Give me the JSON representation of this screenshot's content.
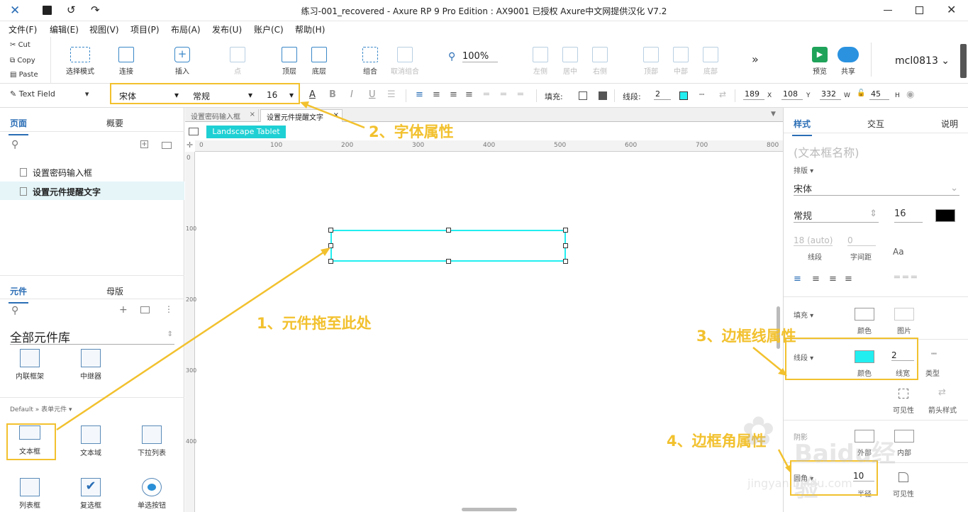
{
  "window": {
    "title": "练习-001_recovered - Axure RP 9 Pro Edition : AX9001 已授权      Axure中文网提供汉化 V7.2",
    "accent": "#2a6db5"
  },
  "menu": [
    "文件(F)",
    "编辑(E)",
    "视图(V)",
    "项目(P)",
    "布局(A)",
    "发布(U)",
    "账户(C)",
    "帮助(H)"
  ],
  "clipboard": {
    "cut": "Cut",
    "copy": "Copy",
    "paste": "Paste"
  },
  "toolbar": {
    "select_mode": "选择模式",
    "connect": "连接",
    "insert": "插入",
    "point": "点",
    "top_layer": "顶层",
    "bottom_layer": "底层",
    "group": "组合",
    "ungroup": "取消组合",
    "zoom": "100%",
    "align_left": "左侧",
    "align_center": "居中",
    "align_right": "右侧",
    "align_top": "顶部",
    "align_middle": "中部",
    "align_bottom": "底部",
    "preview": "预览",
    "share": "共享",
    "user": "mcl0813"
  },
  "format": {
    "widget_type": "Text Field",
    "font": "宋体",
    "weight": "常规",
    "size": "16",
    "fill_label": "填充:",
    "stroke_label": "线段:",
    "stroke_width": "2",
    "x": "189",
    "x_label": "X",
    "y": "108",
    "y_label": "Y",
    "w": "332",
    "w_label": "W",
    "h": "45",
    "h_label": "H"
  },
  "left": {
    "tab_pages": "页面",
    "tab_outline": "概要",
    "pages": [
      "设置密码输入框",
      "设置元件提醒文字"
    ],
    "tab_widgets": "元件",
    "tab_masters": "母版",
    "library": "全部元件库",
    "lib_items": [
      "内联框架",
      "中继器"
    ],
    "category": "Default » 表单元件 ▾",
    "widgets": [
      "文本框",
      "文本域",
      "下拉列表",
      "列表框",
      "复选框",
      "单选按钮"
    ]
  },
  "canvas": {
    "tabs": [
      "设置密码输入框",
      "设置元件提醒文字"
    ],
    "device_badge": "Landscape Tablet",
    "h_ticks": [
      "0",
      "100",
      "200",
      "300",
      "400",
      "500",
      "600",
      "700",
      "800"
    ],
    "v_ticks": [
      "0",
      "100",
      "200",
      "300",
      "400"
    ]
  },
  "right": {
    "tab_style": "样式",
    "tab_interact": "交互",
    "tab_notes": "说明",
    "name_placeholder": "(文本框名称)",
    "layout_label": "排版 ▾",
    "font": "宋体",
    "weight": "常规",
    "size": "16",
    "line_height": "18 (auto)",
    "letter_spacing": "0",
    "line_label": "线段",
    "spacing_label": "字间距",
    "fill_label": "填充 ▾",
    "color_label": "颜色",
    "image_label": "图片",
    "stroke_label": "线段 ▾",
    "stroke_width": "2",
    "stroke_width_label": "线宽",
    "stroke_type_label": "类型",
    "visibility_label": "可见性",
    "arrow_label": "箭头样式",
    "shadow_label": "阴影",
    "outer_label": "外部",
    "inner_label": "内部",
    "corner_label": "圆角 ▾",
    "radius": "10",
    "radius_label": "半径",
    "corner_vis_label": "可见性",
    "stroke_color": "#22eef0"
  },
  "annotations": {
    "a1": "1、元件拖至此处",
    "a2": "2、字体属性",
    "a3": "3、边框线属性",
    "a4": "4、边框角属性"
  },
  "watermark": {
    "brand": "Baidu经验",
    "url": "jingyan.baidu.com"
  }
}
